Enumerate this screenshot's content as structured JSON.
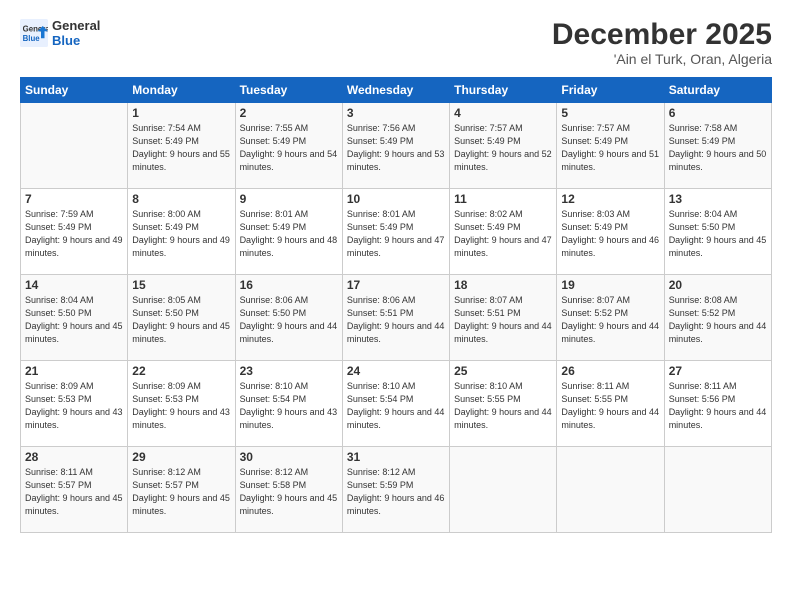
{
  "header": {
    "logo_line1": "General",
    "logo_line2": "Blue",
    "month": "December 2025",
    "location": "'Ain el Turk, Oran, Algeria"
  },
  "days_of_week": [
    "Sunday",
    "Monday",
    "Tuesday",
    "Wednesday",
    "Thursday",
    "Friday",
    "Saturday"
  ],
  "weeks": [
    [
      {
        "day": "",
        "sunrise": "",
        "sunset": "",
        "daylight": ""
      },
      {
        "day": "1",
        "sunrise": "Sunrise: 7:54 AM",
        "sunset": "Sunset: 5:49 PM",
        "daylight": "Daylight: 9 hours and 55 minutes."
      },
      {
        "day": "2",
        "sunrise": "Sunrise: 7:55 AM",
        "sunset": "Sunset: 5:49 PM",
        "daylight": "Daylight: 9 hours and 54 minutes."
      },
      {
        "day": "3",
        "sunrise": "Sunrise: 7:56 AM",
        "sunset": "Sunset: 5:49 PM",
        "daylight": "Daylight: 9 hours and 53 minutes."
      },
      {
        "day": "4",
        "sunrise": "Sunrise: 7:57 AM",
        "sunset": "Sunset: 5:49 PM",
        "daylight": "Daylight: 9 hours and 52 minutes."
      },
      {
        "day": "5",
        "sunrise": "Sunrise: 7:57 AM",
        "sunset": "Sunset: 5:49 PM",
        "daylight": "Daylight: 9 hours and 51 minutes."
      },
      {
        "day": "6",
        "sunrise": "Sunrise: 7:58 AM",
        "sunset": "Sunset: 5:49 PM",
        "daylight": "Daylight: 9 hours and 50 minutes."
      }
    ],
    [
      {
        "day": "7",
        "sunrise": "Sunrise: 7:59 AM",
        "sunset": "Sunset: 5:49 PM",
        "daylight": "Daylight: 9 hours and 49 minutes."
      },
      {
        "day": "8",
        "sunrise": "Sunrise: 8:00 AM",
        "sunset": "Sunset: 5:49 PM",
        "daylight": "Daylight: 9 hours and 49 minutes."
      },
      {
        "day": "9",
        "sunrise": "Sunrise: 8:01 AM",
        "sunset": "Sunset: 5:49 PM",
        "daylight": "Daylight: 9 hours and 48 minutes."
      },
      {
        "day": "10",
        "sunrise": "Sunrise: 8:01 AM",
        "sunset": "Sunset: 5:49 PM",
        "daylight": "Daylight: 9 hours and 47 minutes."
      },
      {
        "day": "11",
        "sunrise": "Sunrise: 8:02 AM",
        "sunset": "Sunset: 5:49 PM",
        "daylight": "Daylight: 9 hours and 47 minutes."
      },
      {
        "day": "12",
        "sunrise": "Sunrise: 8:03 AM",
        "sunset": "Sunset: 5:49 PM",
        "daylight": "Daylight: 9 hours and 46 minutes."
      },
      {
        "day": "13",
        "sunrise": "Sunrise: 8:04 AM",
        "sunset": "Sunset: 5:50 PM",
        "daylight": "Daylight: 9 hours and 45 minutes."
      }
    ],
    [
      {
        "day": "14",
        "sunrise": "Sunrise: 8:04 AM",
        "sunset": "Sunset: 5:50 PM",
        "daylight": "Daylight: 9 hours and 45 minutes."
      },
      {
        "day": "15",
        "sunrise": "Sunrise: 8:05 AM",
        "sunset": "Sunset: 5:50 PM",
        "daylight": "Daylight: 9 hours and 45 minutes."
      },
      {
        "day": "16",
        "sunrise": "Sunrise: 8:06 AM",
        "sunset": "Sunset: 5:50 PM",
        "daylight": "Daylight: 9 hours and 44 minutes."
      },
      {
        "day": "17",
        "sunrise": "Sunrise: 8:06 AM",
        "sunset": "Sunset: 5:51 PM",
        "daylight": "Daylight: 9 hours and 44 minutes."
      },
      {
        "day": "18",
        "sunrise": "Sunrise: 8:07 AM",
        "sunset": "Sunset: 5:51 PM",
        "daylight": "Daylight: 9 hours and 44 minutes."
      },
      {
        "day": "19",
        "sunrise": "Sunrise: 8:07 AM",
        "sunset": "Sunset: 5:52 PM",
        "daylight": "Daylight: 9 hours and 44 minutes."
      },
      {
        "day": "20",
        "sunrise": "Sunrise: 8:08 AM",
        "sunset": "Sunset: 5:52 PM",
        "daylight": "Daylight: 9 hours and 44 minutes."
      }
    ],
    [
      {
        "day": "21",
        "sunrise": "Sunrise: 8:09 AM",
        "sunset": "Sunset: 5:53 PM",
        "daylight": "Daylight: 9 hours and 43 minutes."
      },
      {
        "day": "22",
        "sunrise": "Sunrise: 8:09 AM",
        "sunset": "Sunset: 5:53 PM",
        "daylight": "Daylight: 9 hours and 43 minutes."
      },
      {
        "day": "23",
        "sunrise": "Sunrise: 8:10 AM",
        "sunset": "Sunset: 5:54 PM",
        "daylight": "Daylight: 9 hours and 43 minutes."
      },
      {
        "day": "24",
        "sunrise": "Sunrise: 8:10 AM",
        "sunset": "Sunset: 5:54 PM",
        "daylight": "Daylight: 9 hours and 44 minutes."
      },
      {
        "day": "25",
        "sunrise": "Sunrise: 8:10 AM",
        "sunset": "Sunset: 5:55 PM",
        "daylight": "Daylight: 9 hours and 44 minutes."
      },
      {
        "day": "26",
        "sunrise": "Sunrise: 8:11 AM",
        "sunset": "Sunset: 5:55 PM",
        "daylight": "Daylight: 9 hours and 44 minutes."
      },
      {
        "day": "27",
        "sunrise": "Sunrise: 8:11 AM",
        "sunset": "Sunset: 5:56 PM",
        "daylight": "Daylight: 9 hours and 44 minutes."
      }
    ],
    [
      {
        "day": "28",
        "sunrise": "Sunrise: 8:11 AM",
        "sunset": "Sunset: 5:57 PM",
        "daylight": "Daylight: 9 hours and 45 minutes."
      },
      {
        "day": "29",
        "sunrise": "Sunrise: 8:12 AM",
        "sunset": "Sunset: 5:57 PM",
        "daylight": "Daylight: 9 hours and 45 minutes."
      },
      {
        "day": "30",
        "sunrise": "Sunrise: 8:12 AM",
        "sunset": "Sunset: 5:58 PM",
        "daylight": "Daylight: 9 hours and 45 minutes."
      },
      {
        "day": "31",
        "sunrise": "Sunrise: 8:12 AM",
        "sunset": "Sunset: 5:59 PM",
        "daylight": "Daylight: 9 hours and 46 minutes."
      },
      {
        "day": "",
        "sunrise": "",
        "sunset": "",
        "daylight": ""
      },
      {
        "day": "",
        "sunrise": "",
        "sunset": "",
        "daylight": ""
      },
      {
        "day": "",
        "sunrise": "",
        "sunset": "",
        "daylight": ""
      }
    ]
  ]
}
